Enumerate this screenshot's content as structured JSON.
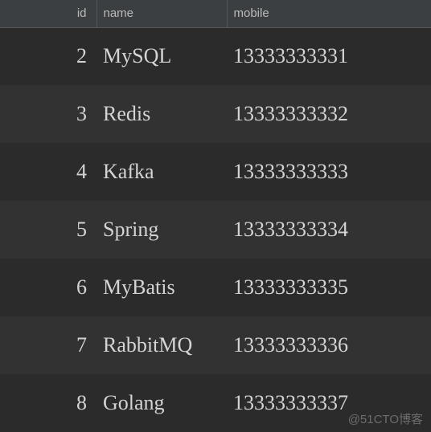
{
  "columns": {
    "id": "id",
    "name": "name",
    "mobile": "mobile"
  },
  "rows": [
    {
      "id": "2",
      "name": "MySQL",
      "mobile": "13333333331"
    },
    {
      "id": "3",
      "name": "Redis",
      "mobile": "13333333332"
    },
    {
      "id": "4",
      "name": "Kafka",
      "mobile": "13333333333"
    },
    {
      "id": "5",
      "name": "Spring",
      "mobile": "13333333334"
    },
    {
      "id": "6",
      "name": "MyBatis",
      "mobile": "13333333335"
    },
    {
      "id": "7",
      "name": "RabbitMQ",
      "mobile": "13333333336"
    },
    {
      "id": "8",
      "name": "Golang",
      "mobile": "13333333337"
    }
  ],
  "watermark": "@51CTO博客"
}
